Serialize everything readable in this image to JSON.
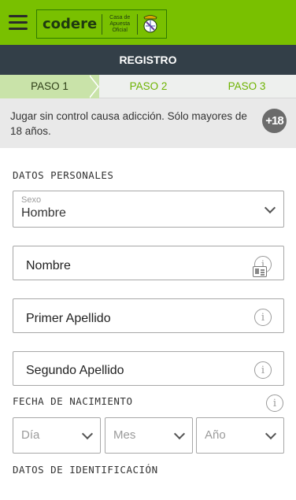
{
  "header": {
    "logo_text": "codere",
    "logo_tagline": "Casa de Apuesta Oficial",
    "crest_icon": "real-madrid-crest",
    "bg_color": "#79c000"
  },
  "titlebar": {
    "title": "REGISTRO",
    "bg_color": "#333f48"
  },
  "steps": [
    {
      "label": "PASO 1",
      "active": true
    },
    {
      "label": "PASO 2",
      "active": false
    },
    {
      "label": "PASO 3",
      "active": false
    }
  ],
  "warning": {
    "text": "Jugar sin control causa adicción. Sólo mayores de 18 años.",
    "badge": "+18"
  },
  "personal": {
    "section_title": "DATOS PERSONALES",
    "sexo": {
      "floating_label": "Sexo",
      "value": "Hombre"
    },
    "nombre": {
      "label": "Nombre"
    },
    "primer_apellido": {
      "label": "Primer Apellido"
    },
    "segundo_apellido": {
      "label": "Segundo Apellido"
    }
  },
  "birth": {
    "section_title": "FECHA DE NACIMIENTO",
    "day_placeholder": "Día",
    "month_placeholder": "Mes",
    "year_placeholder": "Año"
  },
  "identification": {
    "section_title": "DATOS DE IDENTIFICACIÓN"
  },
  "icons": {
    "info": "i",
    "chevron": "chevron-down-icon",
    "id_card": "id-card-icon"
  }
}
